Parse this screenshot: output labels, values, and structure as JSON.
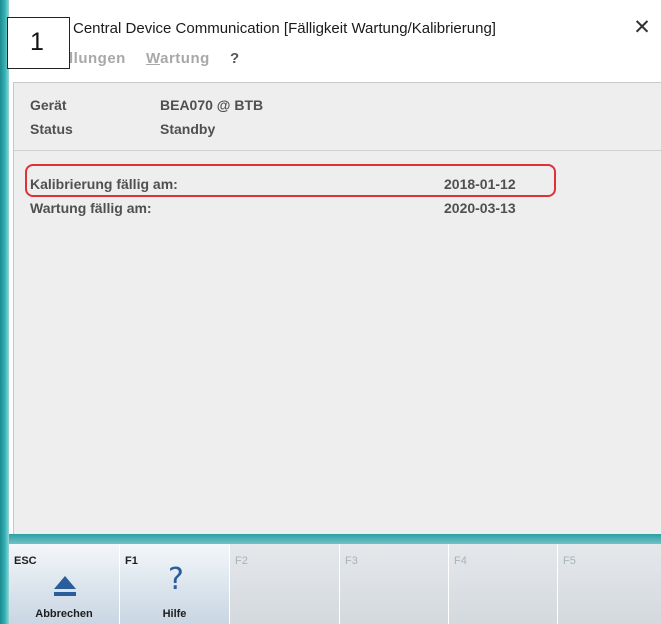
{
  "window": {
    "title": "Central Device Communication [Fälligkeit Wartung/Kalibrierung]",
    "close_glyph": "✕"
  },
  "step_badge": "1",
  "menu": {
    "items": [
      {
        "label": "llungen"
      },
      {
        "label": "Wartung"
      },
      {
        "label": "?"
      }
    ]
  },
  "device_info": {
    "device_label": "Gerät",
    "device_value": "BEA070 @ BTB",
    "status_label": "Status",
    "status_value": "Standby"
  },
  "due_dates": [
    {
      "label": "Kalibrierung fällig am:",
      "value": "2018-01-12",
      "highlighted": true
    },
    {
      "label": "Wartung fällig am:",
      "value": "2020-03-13",
      "highlighted": false
    }
  ],
  "function_keys": [
    {
      "code": "ESC",
      "label": "Abbrechen",
      "icon": "eject-icon",
      "enabled": true
    },
    {
      "code": "F1",
      "label": "Hilfe",
      "icon": "question-mark-icon",
      "enabled": true
    },
    {
      "code": "F2",
      "label": "",
      "enabled": false
    },
    {
      "code": "F3",
      "label": "",
      "enabled": false
    },
    {
      "code": "F4",
      "label": "",
      "enabled": false
    },
    {
      "code": "F5",
      "label": "",
      "enabled": false
    }
  ],
  "colors": {
    "accent_teal": "#37b6b9",
    "highlight_red": "#e0303a",
    "help_icon_blue": "#2a5d9c"
  }
}
